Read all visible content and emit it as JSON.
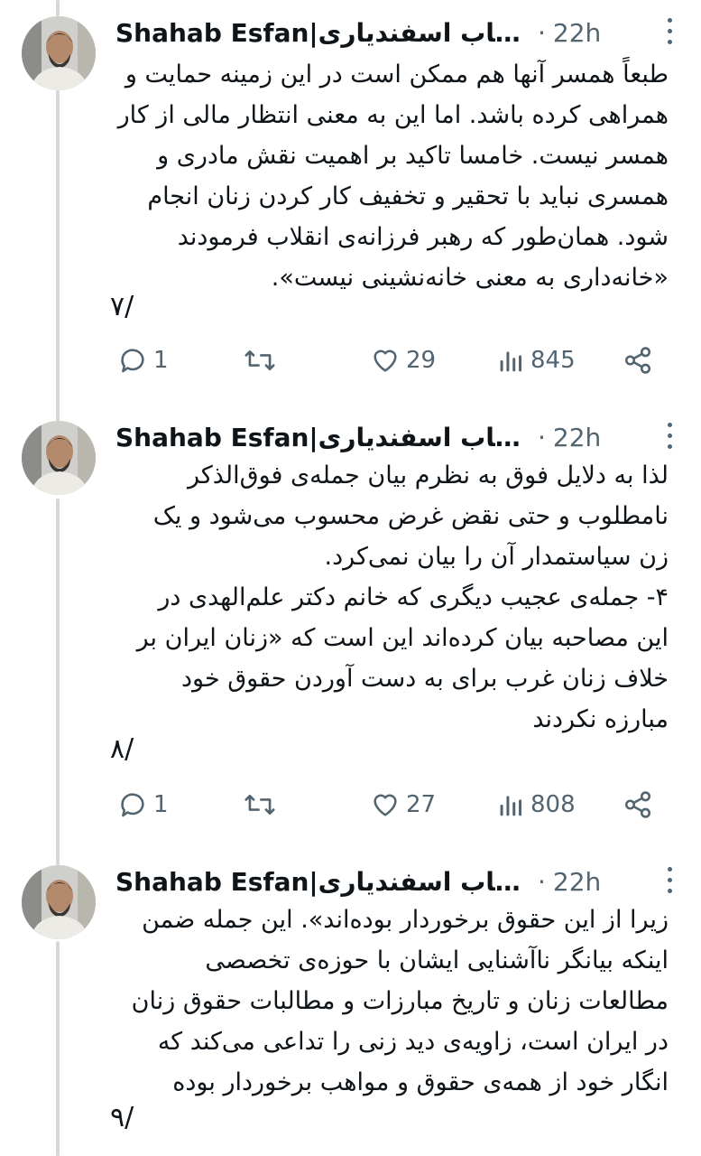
{
  "colors": {
    "text": "#0f1419",
    "muted": "#536471",
    "thread_line": "#cfd9de"
  },
  "tweets": [
    {
      "author": "Shahab Esfan|شهاب اسفندیاری...",
      "time": "22h",
      "separator": "·",
      "text": "طبعاً همسر آنها هم ممکن است در این زمینه حمایت و\nهمراهی کرده باشد. اما این به معنی انتظار مالی از کار\nهمسر نیست. خامسا تاکید بر اهمیت نقش مادری و\nهمسری نباید با تحقیر و تخفیف کار کردن زنان انجام\nشود. همان‌طور که رهبر فرزانه‌ی انقلاب فرمودند\n«خانه‌داری به معنی خانه‌نشینی نیست».",
      "thread_num": "۷/",
      "replies": "1",
      "retweets": "",
      "likes": "29",
      "views": "845"
    },
    {
      "author": "Shahab Esfan|شهاب اسفندیاری...",
      "time": "22h",
      "separator": "·",
      "text": "لذا به دلایل فوق به نظرم بیان جمله‌ی فوق‌الذکر\nنامطلوب و حتی نقض غرض محسوب می‌شود و یک\nزن سیاستمدار آن را بیان نمی‌کرد.\n۴- جمله‌ی عجیب دیگری که خانم دکتر علم‌الهدی در\nاین مصاحبه بیان کرده‌اند این است که «زنان ایران بر\nخلاف زنان غرب برای به دست آوردن حقوق خود\nمبارزه نکردند",
      "thread_num": "۸/",
      "replies": "1",
      "retweets": "",
      "likes": "27",
      "views": "808"
    },
    {
      "author": "Shahab Esfan|شهاب اسفندیاری...",
      "time": "22h",
      "separator": "·",
      "text": "زیرا از این حقوق برخوردار بوده‌اند». این جمله ضمن\nاینکه بیانگر ناآشنایی ایشان با حوزه‌ی تخصصی\nمطالعات زنان و تاریخ مبارزات و مطالبات حقوق زنان\nدر ایران است، زاویه‌ی دید زنی را تداعی می‌کند که\nانگار خود از همه‌ی حقوق و مواهب برخوردار بوده",
      "thread_num": "۹/"
    }
  ]
}
